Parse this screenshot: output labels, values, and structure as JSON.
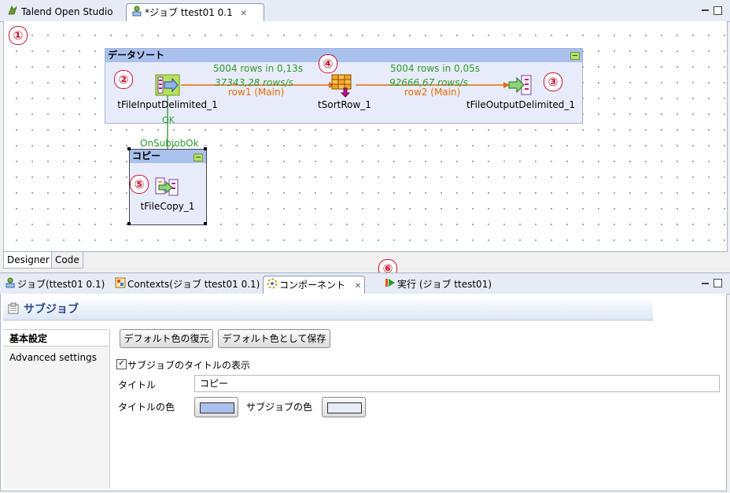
{
  "editor_tabs": {
    "studio_label": "Talend Open Studio",
    "job_label": "*ジョブ ttest01 0.1"
  },
  "canvas": {
    "subjob1": {
      "title": "データソート",
      "color": "#a9c1ec",
      "components": {
        "input": "tFileInputDelimited_1",
        "sort": "tSortRow_1",
        "output": "tFileOutputDelimited_1"
      },
      "flow1": {
        "stats": "5004 rows in 0,13s",
        "rate": "37343,28 rows/s",
        "name": "row1 (Main)"
      },
      "flow2": {
        "stats": "5004 rows in 0,05s",
        "rate": "92666,67 rows/s",
        "name": "row2 (Main)"
      },
      "ok_label": "OK"
    },
    "trigger_label": "OnSubjobOk",
    "subjob2": {
      "title": "コピー",
      "component": "tFileCopy_1"
    },
    "markers": [
      "①",
      "②",
      "③",
      "④",
      "⑤",
      "⑥"
    ]
  },
  "designer_tabs": [
    "Designer",
    "Code"
  ],
  "view_tabs": {
    "job": "ジョブ(ttest01 0.1)",
    "contexts": "Contexts(ジョブ ttest01 0.1)",
    "component": "コンポーネント",
    "run": "実行 (ジョブ ttest01)"
  },
  "properties": {
    "header": "サブジョブ",
    "side_tabs": [
      "基本設定",
      "Advanced settings"
    ],
    "restore_button": "デフォルト色の復元",
    "save_button": "デフォルト色として保存",
    "show_title_checkbox": "サブジョブのタイトルの表示",
    "show_title_checked": true,
    "title_label": "タイトル",
    "title_value": "コピー",
    "title_color_label": "タイトルの色",
    "title_color": "#a9c1ec",
    "subjob_color_label": "サブジョブの色",
    "subjob_color": "#e8ecfa"
  }
}
